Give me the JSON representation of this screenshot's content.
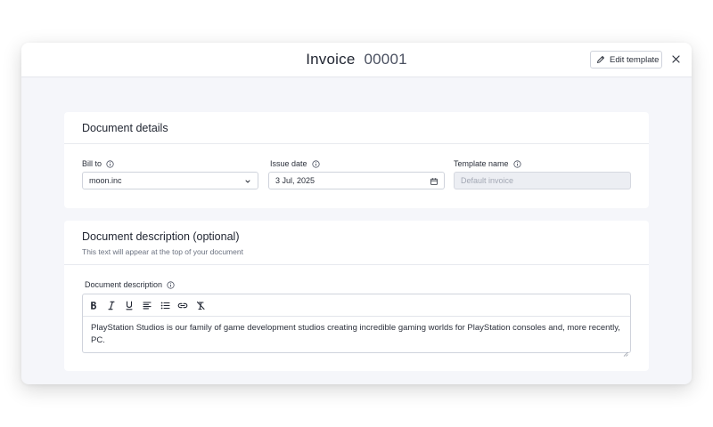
{
  "header": {
    "title": "Invoice",
    "number": "00001",
    "edit_template_label": "Edit template"
  },
  "document_details": {
    "title": "Document details",
    "bill_to": {
      "label": "Bill to",
      "value": "moon.inc"
    },
    "issue_date": {
      "label": "Issue date",
      "value": "3 Jul, 2025"
    },
    "template_name": {
      "label": "Template name",
      "placeholder": "Default invoice"
    }
  },
  "document_description": {
    "title": "Document description (optional)",
    "subtitle": "This text will appear at the top of your document",
    "field_label": "Document description",
    "toolbar": [
      "bold-icon",
      "italic-icon",
      "underline-icon",
      "align-left-icon",
      "bulleted-list-icon",
      "link-icon",
      "clear-format-icon"
    ],
    "text": "PlayStation Studios is our family of game development studios creating incredible gaming worlds for PlayStation consoles and, more recently, PC."
  },
  "colors": {
    "page_bg": "#ffffff",
    "modal_bg": "#f5f6fa",
    "card_bg": "#ffffff",
    "border": "#cfd3dc",
    "disabled_input_bg": "#eceef3"
  }
}
